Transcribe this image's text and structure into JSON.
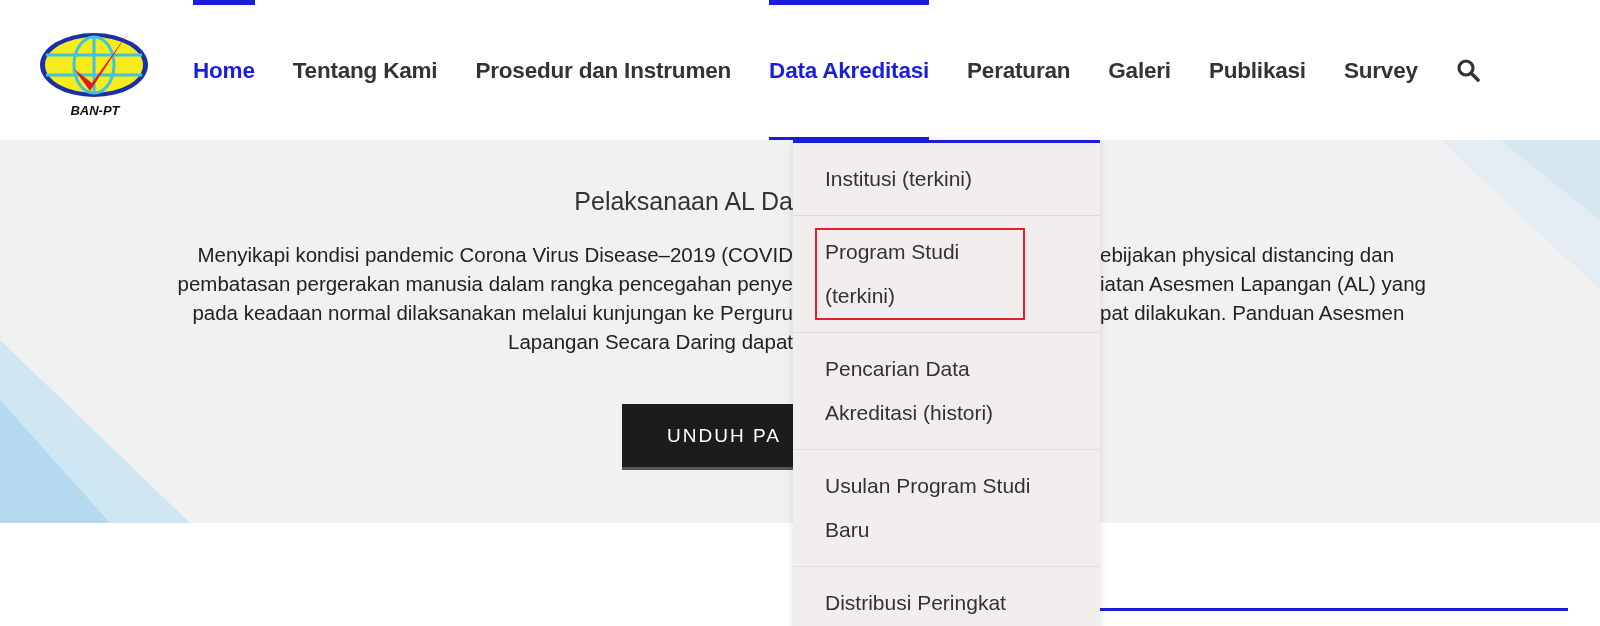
{
  "header": {
    "logo_text": "BAN-PT",
    "nav": [
      {
        "label": "Home",
        "selected": true,
        "expanded": false
      },
      {
        "label": "Tentang Kami",
        "selected": false,
        "expanded": false
      },
      {
        "label": "Prosedur dan Instrumen",
        "selected": false,
        "expanded": false
      },
      {
        "label": "Data Akreditasi",
        "selected": true,
        "expanded": true
      },
      {
        "label": "Peraturan",
        "selected": false,
        "expanded": false
      },
      {
        "label": "Galeri",
        "selected": false,
        "expanded": false
      },
      {
        "label": "Publikasi",
        "selected": false,
        "expanded": false
      },
      {
        "label": "Survey",
        "selected": false,
        "expanded": false
      }
    ]
  },
  "dropdown": {
    "items": [
      {
        "label": "Institusi (terkini)",
        "outlined": false
      },
      {
        "label": "Program Studi (terkini)",
        "outlined": true
      },
      {
        "label": "Pencarian Data Akreditasi (histori)",
        "outlined": false
      },
      {
        "label": "Usulan Program Studi Baru",
        "outlined": false
      },
      {
        "label": "Distribusi Peringkat",
        "outlined": false
      }
    ]
  },
  "hero": {
    "title": "Pelaksanaan AL Da",
    "lines": [
      {
        "left": "Menyikapi kondisi pandemic Corona Virus Disease–2019 (COVID",
        "right": "ebijakan physical distancing dan"
      },
      {
        "left": "pembatasan pergerakan manusia dalam rangka pencegahan penye",
        "right": "iatan Asesmen Lapangan (AL) yang"
      },
      {
        "left": "pada keadaan normal dilaksanakan melalui kunjungan ke Perguru",
        "right": "pat dilakukan. Panduan Asesmen"
      },
      {
        "left": "Lapangan Secara Daring dapat"
      }
    ],
    "button": "UNDUH PA"
  }
}
